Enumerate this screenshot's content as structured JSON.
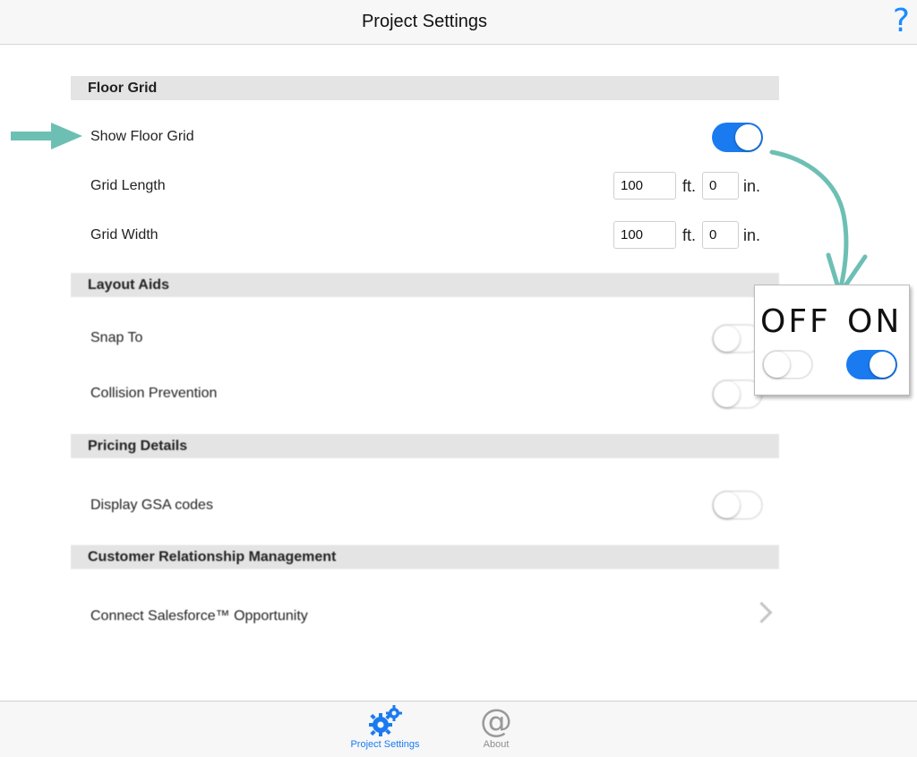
{
  "nav": {
    "title": "Project Settings",
    "help_icon": "?"
  },
  "sections": {
    "floor_grid": {
      "header": "Floor Grid",
      "show_floor_grid": {
        "label": "Show Floor Grid",
        "on": true
      },
      "grid_length": {
        "label": "Grid Length",
        "feet": "100",
        "inches": "0"
      },
      "grid_width": {
        "label": "Grid Width",
        "feet": "100",
        "inches": "0"
      },
      "unit_ft": "ft.",
      "unit_in": "in."
    },
    "layout_aids": {
      "header": "Layout Aids",
      "snap_to": {
        "label": "Snap To",
        "on": false
      },
      "collision_prevention": {
        "label": "Collision Prevention",
        "on": false
      }
    },
    "pricing_details": {
      "header": "Pricing Details",
      "display_gsa": {
        "label": "Display GSA codes",
        "on": false
      }
    },
    "crm": {
      "header": "Customer Relationship Management",
      "connect_salesforce": {
        "label": "Connect Salesforce™ Opportunity"
      }
    }
  },
  "callout": {
    "off_label": "OFF",
    "on_label": "ON"
  },
  "tabbar": {
    "tabs": [
      {
        "label": "Project Settings",
        "icon": "gears-icon",
        "active": true
      },
      {
        "label": "About",
        "icon": "at-icon",
        "active": false
      }
    ]
  },
  "colors": {
    "accent": "#1a7bf0",
    "teal_annotation": "#6dbfb4",
    "section_bg": "#e4e4e4"
  }
}
